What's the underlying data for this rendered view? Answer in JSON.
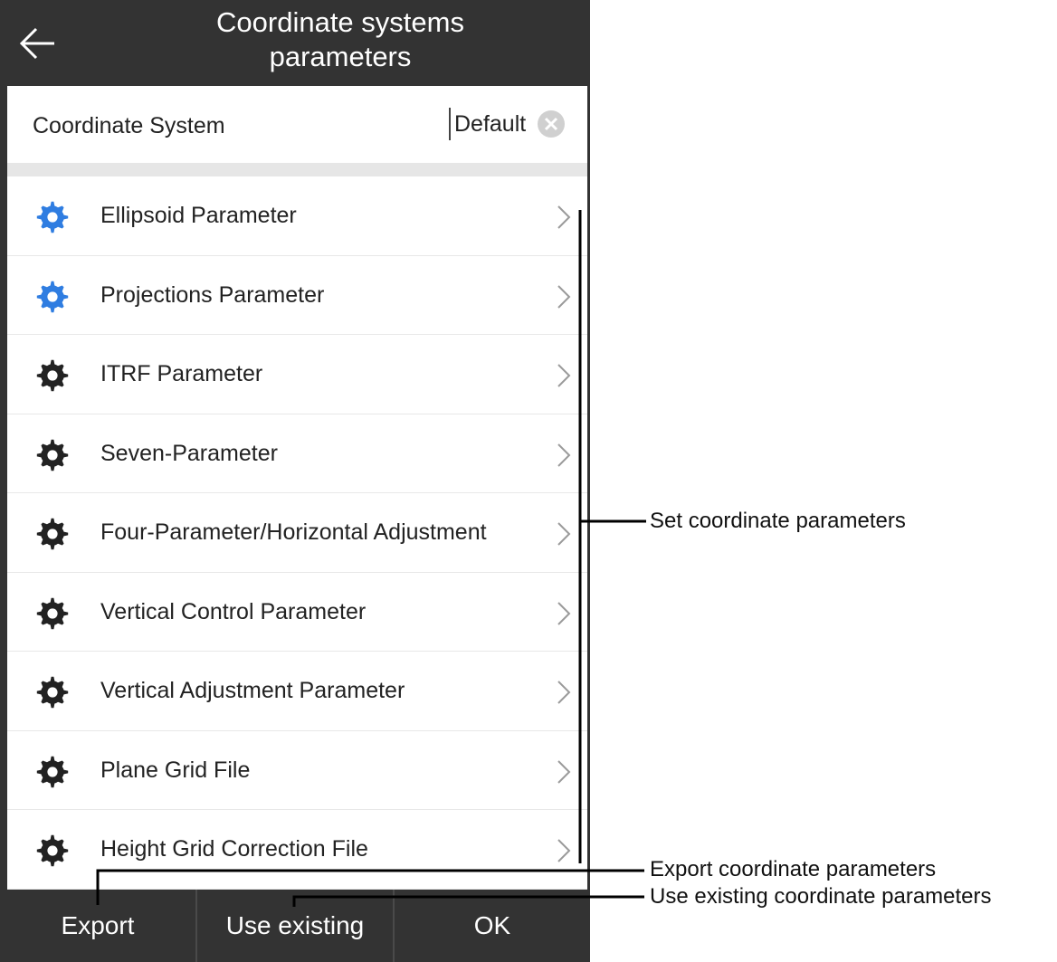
{
  "header": {
    "back_icon": "arrow-left-icon",
    "title_line1": "Coordinate systems",
    "title_line2": "parameters"
  },
  "coordinate_system": {
    "label": "Coordinate System",
    "value": "Default",
    "clear_icon": "clear-circle-icon"
  },
  "parameter_items": [
    {
      "label": "Ellipsoid Parameter",
      "icon": "gear-icon",
      "icon_color": "#2f7de1"
    },
    {
      "label": "Projections Parameter",
      "icon": "gear-icon",
      "icon_color": "#2f7de1"
    },
    {
      "label": "ITRF Parameter",
      "icon": "gear-icon",
      "icon_color": "#222222"
    },
    {
      "label": "Seven-Parameter",
      "icon": "gear-icon",
      "icon_color": "#222222"
    },
    {
      "label": "Four-Parameter/Horizontal Adjustment",
      "icon": "gear-icon",
      "icon_color": "#222222"
    },
    {
      "label": "Vertical Control Parameter",
      "icon": "gear-icon",
      "icon_color": "#222222"
    },
    {
      "label": "Vertical Adjustment Parameter",
      "icon": "gear-icon",
      "icon_color": "#222222"
    },
    {
      "label": "Plane Grid File",
      "icon": "gear-icon",
      "icon_color": "#222222"
    },
    {
      "label": "Height Grid Correction File",
      "icon": "gear-icon",
      "icon_color": "#222222"
    }
  ],
  "bottom_bar": {
    "export_label": "Export",
    "use_existing_label": "Use existing",
    "ok_label": "OK"
  },
  "annotations": {
    "set_params": "Set coordinate parameters",
    "export_params": "Export coordinate parameters",
    "use_existing_params": "Use existing coordinate parameters"
  },
  "colors": {
    "header_bg": "#333333",
    "accent_blue": "#2f7de1",
    "text_dark": "#222222",
    "divider": "#e8e8e8"
  }
}
